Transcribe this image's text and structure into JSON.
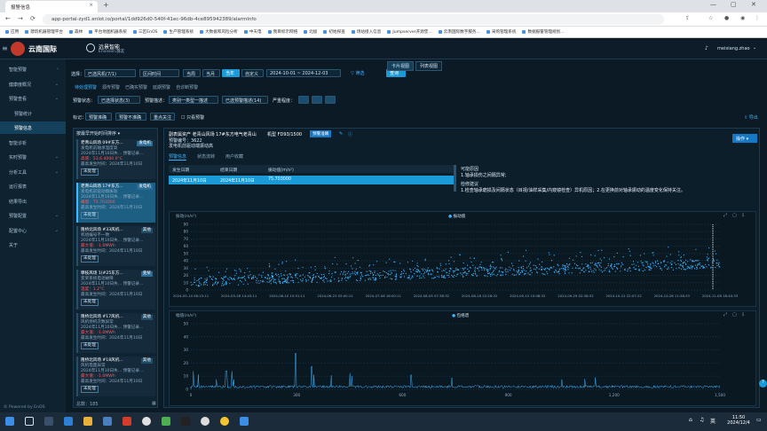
{
  "browser": {
    "tab_title": "报警信息",
    "url": "app-portal-zyd1.enlot.io/portal/1dd926d0-540f-41ec-96db-4ce895942389/alarmInfo",
    "bookmarks": [
      "应用",
      "建筑机器管理平台",
      "森林",
      "平台地图机器系统",
      "三区EnOS",
      "生产管理系统",
      "大数据和风险分析",
      "中天电",
      "我目标示网络",
      "北极",
      "初始探查",
      "场站接入信息",
      "Jumpserver开源堡...",
      "云南国际数字服务...",
      "采购管理系统",
      "数据报警管理规划..."
    ]
  },
  "header": {
    "brand": "云南国际",
    "brand_sub": "远景智能",
    "brand_sub_en": "Envision.群友",
    "user": "meixiang.zhao"
  },
  "sidebar": {
    "items": [
      {
        "label": "智能预警",
        "chev": "‹"
      },
      {
        "label": "健康度概况",
        "chev": "⌄"
      },
      {
        "label": "预警查看",
        "chev": "⌄"
      },
      {
        "label": "预警统计",
        "chev": ""
      },
      {
        "label": "预警信息",
        "chev": ""
      },
      {
        "label": "智能诊析",
        "chev": ""
      },
      {
        "label": "实时预警",
        "chev": "⌄"
      },
      {
        "label": "分析工具",
        "chev": "⌄"
      },
      {
        "label": "运行报表",
        "chev": ""
      },
      {
        "label": "结果导出",
        "chev": ""
      },
      {
        "label": "预警配置",
        "chev": "⌄"
      },
      {
        "label": "配置中心",
        "chev": "⌄"
      },
      {
        "label": "关于",
        "chev": ""
      }
    ],
    "footer": "© Powered by EnOS"
  },
  "filters": {
    "select_label": "选择：",
    "site": "已选风机(7/1)",
    "site2": "区间时间",
    "quick_today": "当周",
    "quick_month": "当月",
    "quick_year": "当年",
    "quick_custom": "自定义",
    "date_range": "2024-10-01  ~  2024-12-03",
    "filter_label": "筛选",
    "query_button": "查询",
    "view_tabs": [
      "卡片视图",
      "列表视图"
    ],
    "status_tabs": [
      "待处理预警",
      "源传预警",
      "已确实预警",
      "延期预警",
      "自诊断预警"
    ],
    "row2": {
      "state_label": "预警状态：",
      "state_value": "已选择状态(3)",
      "desc_label": "预警描述：",
      "desc_value": "类别一类型一描述",
      "type_value": "已选预警描述(14)",
      "level_label": "严重程度："
    },
    "row3": {
      "label": "标记：",
      "btn1": "预警准确",
      "btn2": "预警不准确",
      "btn3": "重点关注",
      "checkbox": "只看预警"
    },
    "export": "导出"
  },
  "alarm_list": {
    "header": "按最早开始时间排序",
    "footer": "总数：185",
    "cards": [
      {
        "title": "老青山风场 09#东方...",
        "tag": "发电机",
        "l1": "发电机前轴承温度高",
        "l2": "2024年11月10日失... 预警记录...",
        "l3": "高值：53.6 4000 0°C",
        "l4": "最高发生时间：2024年11月10日",
        "badge": "未处理"
      },
      {
        "title": "老青山风场 17#东方...",
        "tag": "发电机",
        "l1": "发电机前驱动端振动",
        "l2": "2024年11月10日失... 预警记录...",
        "l3": "峰值：75.703000",
        "l4": "最高发生时间：2024年11月10日",
        "badge": "未处理"
      },
      {
        "title": "隆桥北风场 #33风机...",
        "tag": "其他",
        "l1": "机组编号不一致",
        "l2": "2024年11月10日失... 预警记录...",
        "l3": "最大值：-1.0MWh",
        "l4": "最高发生时间：2024年11月10日",
        "badge": "未处理"
      },
      {
        "title": "攀枝风场 1(#25东方...",
        "tag": "变桨",
        "l1": "变桨系统电池故障",
        "l2": "2024年11月10日失... 预警记录...",
        "l3": "温度：1.2°C",
        "l4": "最高发生时间：2024年11月10日",
        "badge": "未处理"
      },
      {
        "title": "隆桥北风场 #17风机...",
        "tag": "其他",
        "l1": "风机停机次数异常",
        "l2": "2024年11月10日失... 预警记录...",
        "l3": "最大值：-1.0MWh",
        "l4": "最高发生时间：2024年11月10日",
        "badge": "未处理"
      },
      {
        "title": "隆桥北风场 #18风机...",
        "tag": "其他",
        "l1": "风机电量异常",
        "l2": "2024年11月10日失... 预警记录...",
        "l3": "最大值：-1.0MWh",
        "l4": "最高发生时间：2024年11月10日",
        "badge": "未处理"
      }
    ]
  },
  "detail": {
    "title": "副表属资产 老青山风场 17#东方电气老青山",
    "model": "机型 FD93/1500",
    "status": "预警准确",
    "code": "预警编号：3622",
    "desc": "发电机前驱动端振动高",
    "tabs": [
      "预警信息",
      "状态流转",
      "用户收藏"
    ],
    "table_headers": [
      "发生日期",
      "结束日期",
      "振动值(m/s²)"
    ],
    "table_row": [
      "2024年11月10日",
      "2024年11月10日",
      "75.703000"
    ],
    "cause_title": "可能原因",
    "cause": "1.轴承损伤之间隔异常;",
    "suggestion_title": "检修建议",
    "suggestion": "1.检查轴承磨损及间隔状态（目视/油样采集/内窥镜检查）异机原因；2.在更换前对轴承振动的温度变化保持关注。",
    "operate": "操作"
  },
  "chart1": {
    "ylabel": "振动(m/s²)",
    "legend": "振动值",
    "ticks_y": [
      "90",
      "80",
      "70",
      "60",
      "50",
      "40",
      "30",
      "20",
      "10",
      "0"
    ],
    "ticks_x": [
      "2024-05-14 08:15:11",
      "2024-05-28 14:45:11",
      "2024-06-10 15:51:11",
      "2024-06-23 05:00:11",
      "2024-07-06 16:00:11",
      "2024-08-05 07:38:32",
      "2024-08-18 22:26:32",
      "2024-09-15 10:08:32",
      "2024-09-29 02:38:32",
      "2024-10-12 22:07:22",
      "2024-10-26 11:38:33",
      "2024-11-08 18:40:33"
    ]
  },
  "chart2": {
    "ylabel": "幅值(m/s²)",
    "legend": "包络谱",
    "ticks_y": [
      "50",
      "40",
      "30",
      "20",
      "10",
      "0"
    ],
    "ticks_x": [
      "0",
      "300",
      "600",
      "900",
      "1,200",
      "1,500"
    ]
  },
  "taskbar": {
    "time": "11:50",
    "date": "2024/12/4",
    "lang": "英"
  }
}
